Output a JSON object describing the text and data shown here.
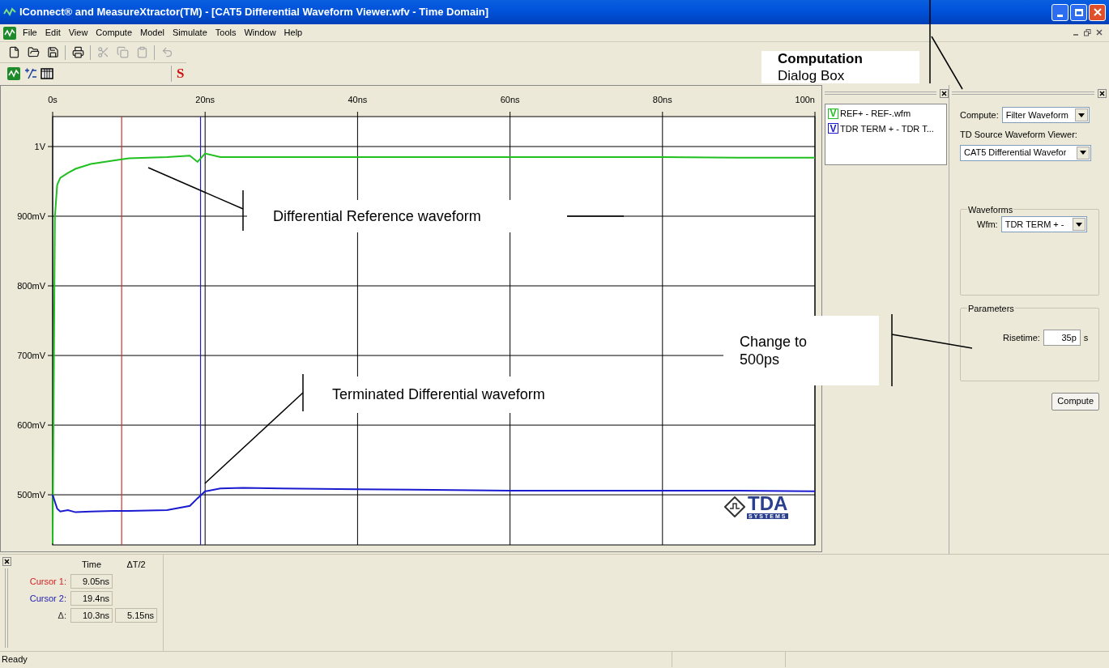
{
  "window": {
    "title": "IConnect® and MeasureXtractor(TM) - [CAT5 Differential Waveform Viewer.wfv - Time Domain]"
  },
  "menu": [
    "File",
    "Edit",
    "View",
    "Compute",
    "Model",
    "Simulate",
    "Tools",
    "Window",
    "Help"
  ],
  "toolbar": [
    {
      "kind": "new",
      "disabled": false
    },
    {
      "kind": "open",
      "disabled": false
    },
    {
      "kind": "save",
      "disabled": false
    },
    {
      "kind": "sep"
    },
    {
      "kind": "print",
      "disabled": false
    },
    {
      "kind": "sep"
    },
    {
      "kind": "cut",
      "disabled": true
    },
    {
      "kind": "copy",
      "disabled": true
    },
    {
      "kind": "paste",
      "disabled": true
    },
    {
      "kind": "sep"
    },
    {
      "kind": "undo",
      "disabled": true
    }
  ],
  "toolbar2": [
    {
      "kind": "waveform"
    },
    {
      "kind": "math"
    },
    {
      "kind": "table"
    },
    {
      "kind": "letter",
      "text": "S"
    }
  ],
  "viewer": {
    "chart_data": {
      "type": "line",
      "x": [
        0,
        0.3,
        0.6,
        1,
        2,
        3,
        5,
        8,
        10,
        15,
        18,
        19,
        20,
        22,
        25,
        30,
        40,
        50,
        60,
        70,
        80,
        90,
        100
      ],
      "series": [
        {
          "color": "#20c020",
          "values": [
            430,
            900,
            945,
            955,
            962,
            968,
            975,
            980,
            983,
            985,
            987,
            978,
            990,
            985,
            985,
            985,
            985,
            985,
            985,
            985,
            985,
            984,
            984
          ]
        },
        {
          "color": "#1a1ad0",
          "values": [
            500,
            490,
            480,
            476,
            478,
            475,
            476,
            477,
            477,
            478,
            484,
            495,
            505,
            509,
            510,
            509,
            508,
            507,
            506,
            506,
            506,
            506,
            505
          ]
        }
      ],
      "xlim": [
        0,
        100
      ],
      "ylim": [
        428,
        1043
      ],
      "grid": true,
      "xticks": [
        {
          "value": 0,
          "label": "0s"
        },
        {
          "value": 20,
          "label": "20ns"
        },
        {
          "value": 40,
          "label": "40ns"
        },
        {
          "value": 60,
          "label": "60ns"
        },
        {
          "value": 80,
          "label": "80ns"
        },
        {
          "value": 100,
          "label": "100n"
        }
      ],
      "yticks": [
        {
          "value": 900,
          "label": "900mV"
        },
        {
          "value": 800,
          "label": "800mV"
        },
        {
          "value": 700,
          "label": "700mV"
        },
        {
          "value": 600,
          "label": "600mV"
        },
        {
          "value": 500,
          "label": "500mV"
        }
      ],
      "ref_lines": [
        {
          "axis": "y",
          "value": 1000,
          "label": "1V",
          "color": "#000000"
        },
        {
          "axis": "x",
          "value": 9.05,
          "color": "#d03030"
        },
        {
          "axis": "x",
          "value": 19.4,
          "color": "#2020c0"
        }
      ]
    },
    "logo": {
      "mark": "TDA",
      "sub": "SYSTEMS"
    }
  },
  "waveform_list": [
    {
      "badge": "V",
      "label": "REF+ - REF-.wfm",
      "color": "#20c020"
    },
    {
      "badge": "V",
      "label": "TDR TERM + - TDR T...",
      "color": "#1a1ad0"
    }
  ],
  "computation": {
    "compute_label": "Compute:",
    "compute_select": "Filter Waveform",
    "source_label": "TD Source Waveform Viewer:",
    "source_select": "CAT5 Differential Wavefor",
    "waveforms_group": {
      "title": "Waveforms",
      "label": "Wfm:",
      "value": "TDR TERM + -"
    },
    "parameters_group": {
      "title": "Parameters",
      "label": "Risetime:",
      "value": "35p",
      "unit": "s"
    },
    "button": "Compute"
  },
  "cursor_panel": {
    "columns": [
      "Time",
      "ΔT/2"
    ],
    "rows": [
      {
        "label": "Cursor 1:",
        "color": "#d02020",
        "values": [
          "9.05ns"
        ]
      },
      {
        "label": "Cursor 2:",
        "color": "#2020b0",
        "values": [
          "19.4ns"
        ]
      },
      {
        "label": "Δ:",
        "color": "#333333",
        "values": [
          "10.3ns",
          "5.15ns"
        ]
      }
    ]
  },
  "status_bar": {
    "text": "Ready"
  },
  "callouts": [
    {
      "title": "Computation",
      "text": "Dialog Box"
    },
    {
      "text": "Differential Reference waveform"
    },
    {
      "text": "Change to 500ps"
    },
    {
      "text": "Terminated Differential waveform"
    }
  ]
}
